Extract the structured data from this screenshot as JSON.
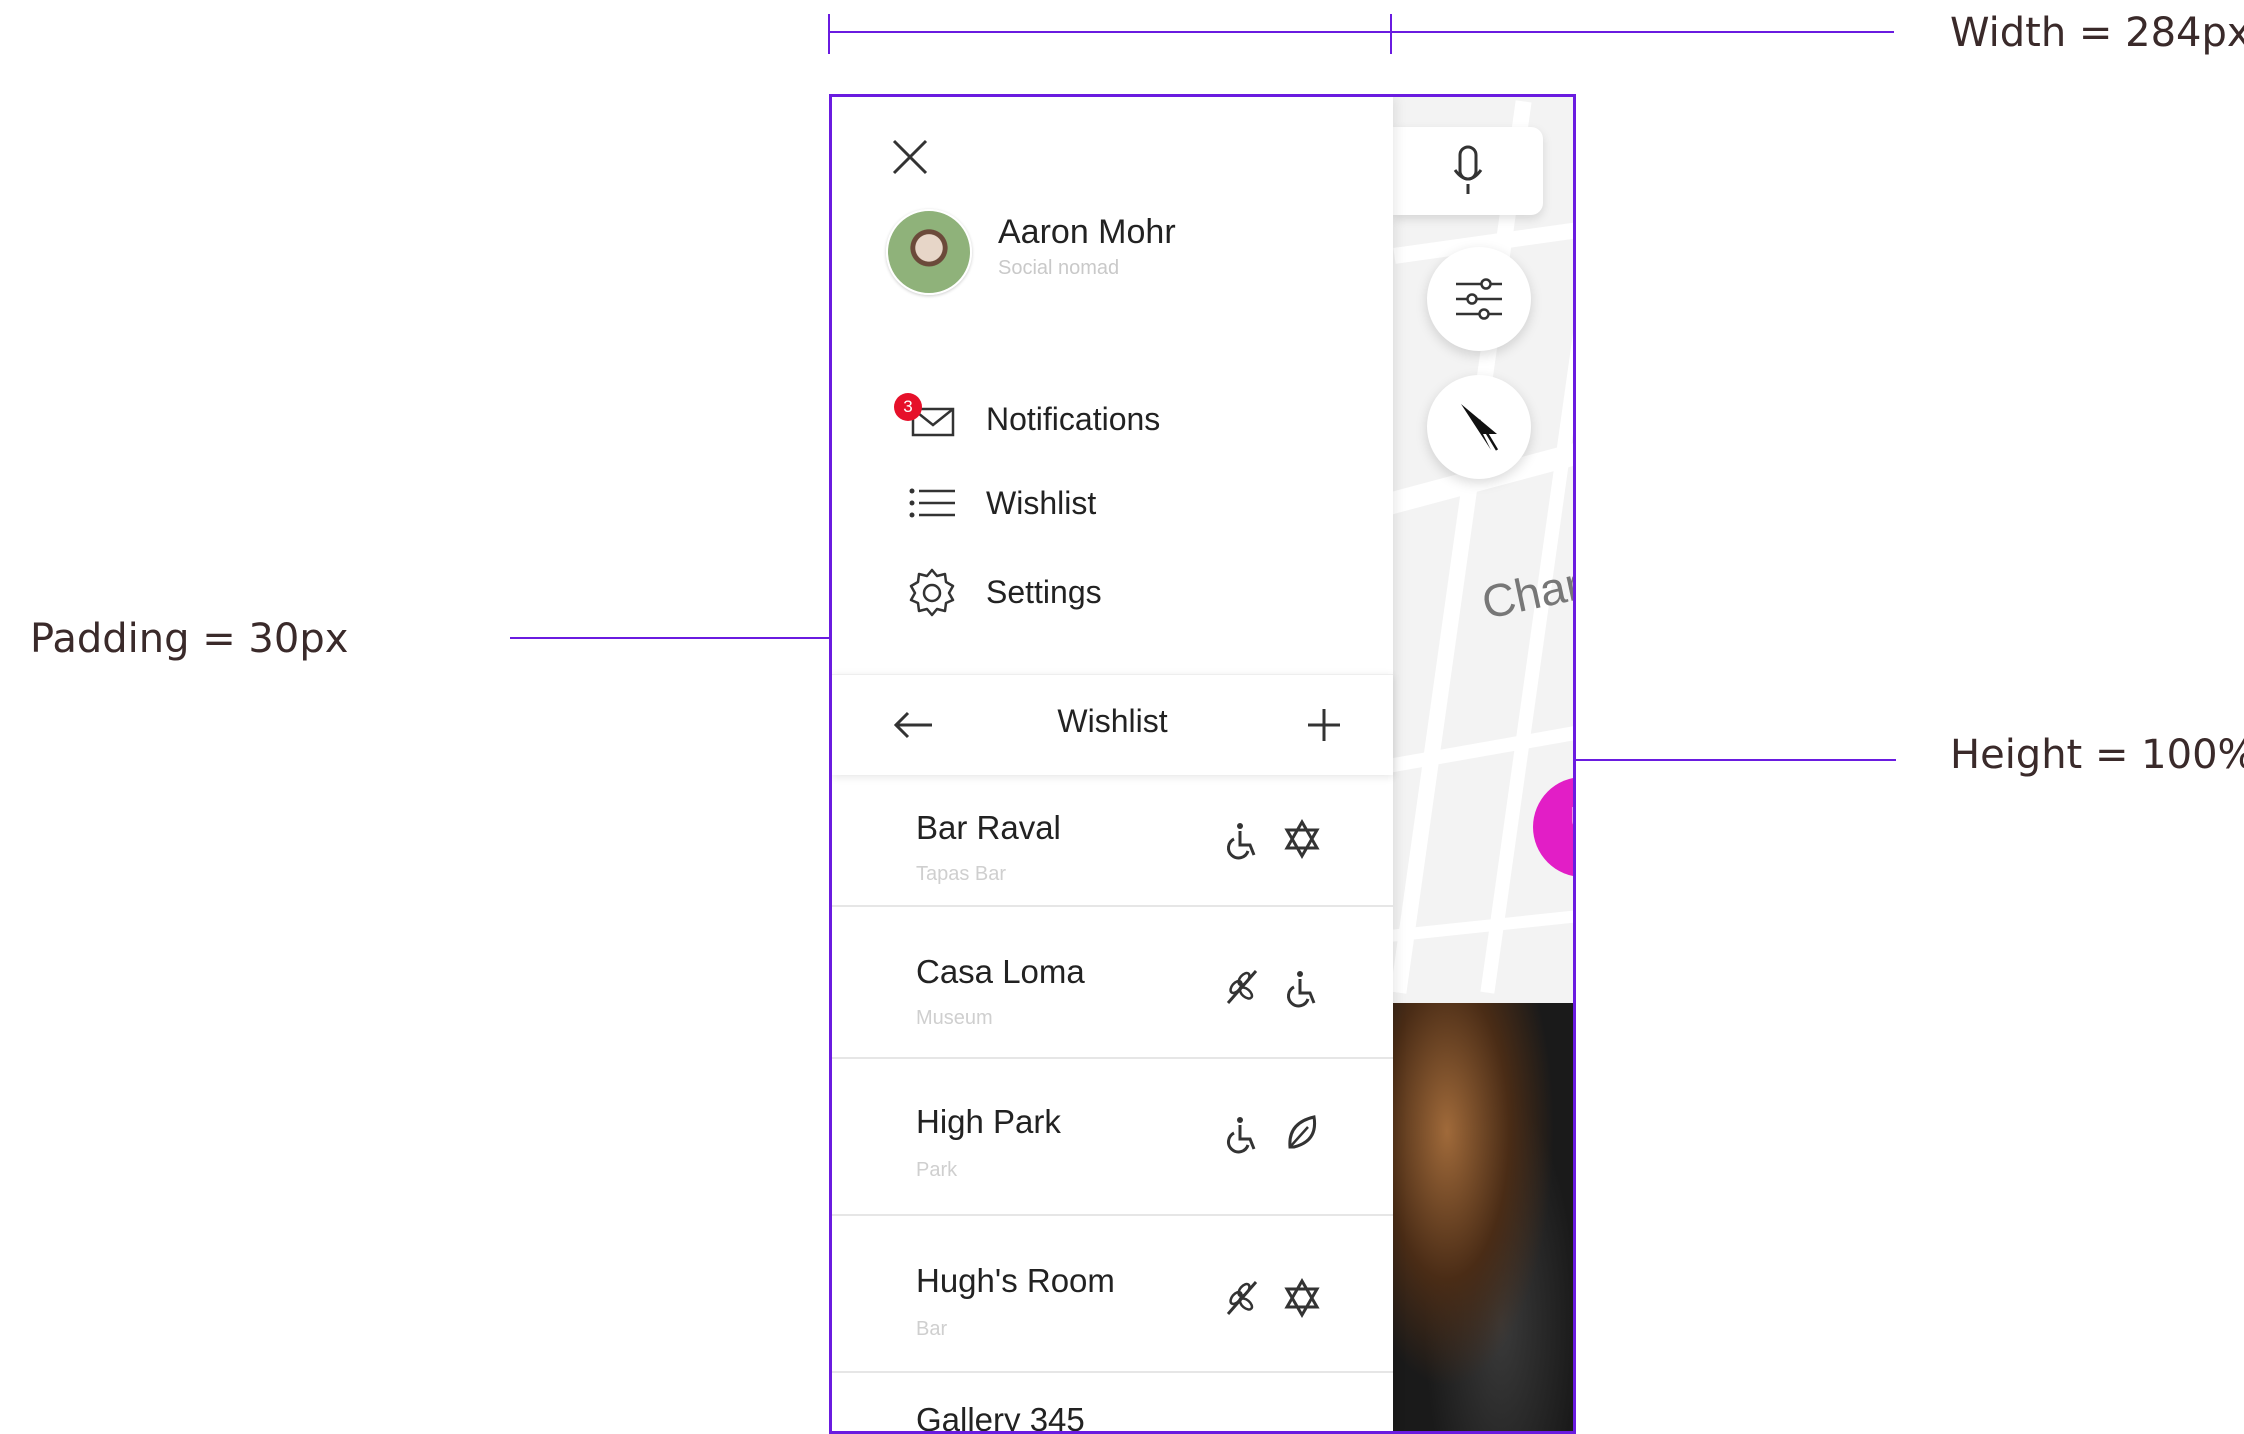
{
  "annotations": {
    "width": "Width = 284px",
    "padding": "Padding = 30px",
    "height": "Height = 100%"
  },
  "colors": {
    "guide": "#6a1be0",
    "badge": "#e6102a",
    "fab_pink": "#e21ec6"
  },
  "user": {
    "name": "Aaron Mohr",
    "subtitle": "Social nomad"
  },
  "menu": [
    {
      "label": "Notifications",
      "icon": "mail-icon",
      "badge": "3"
    },
    {
      "label": "Wishlist",
      "icon": "list-icon"
    },
    {
      "label": "Settings",
      "icon": "gear-icon"
    }
  ],
  "wishlist_header": {
    "title": "Wishlist"
  },
  "wishlist": [
    {
      "name": "Bar Raval",
      "type": "Tapas Bar",
      "icons": [
        "wheelchair-icon",
        "star-of-david-icon"
      ]
    },
    {
      "name": "Casa Loma",
      "type": "Museum",
      "icons": [
        "wheat-icon",
        "wheelchair-icon"
      ]
    },
    {
      "name": "High Park",
      "type": "Park",
      "icons": [
        "wheelchair-icon",
        "leaf-icon"
      ]
    },
    {
      "name": "Hugh's Room",
      "type": "Bar",
      "icons": [
        "wheat-icon",
        "star-of-david-icon"
      ]
    },
    {
      "name": "Gallery 345",
      "type": ""
    }
  ],
  "map": {
    "street_label": "Char"
  }
}
